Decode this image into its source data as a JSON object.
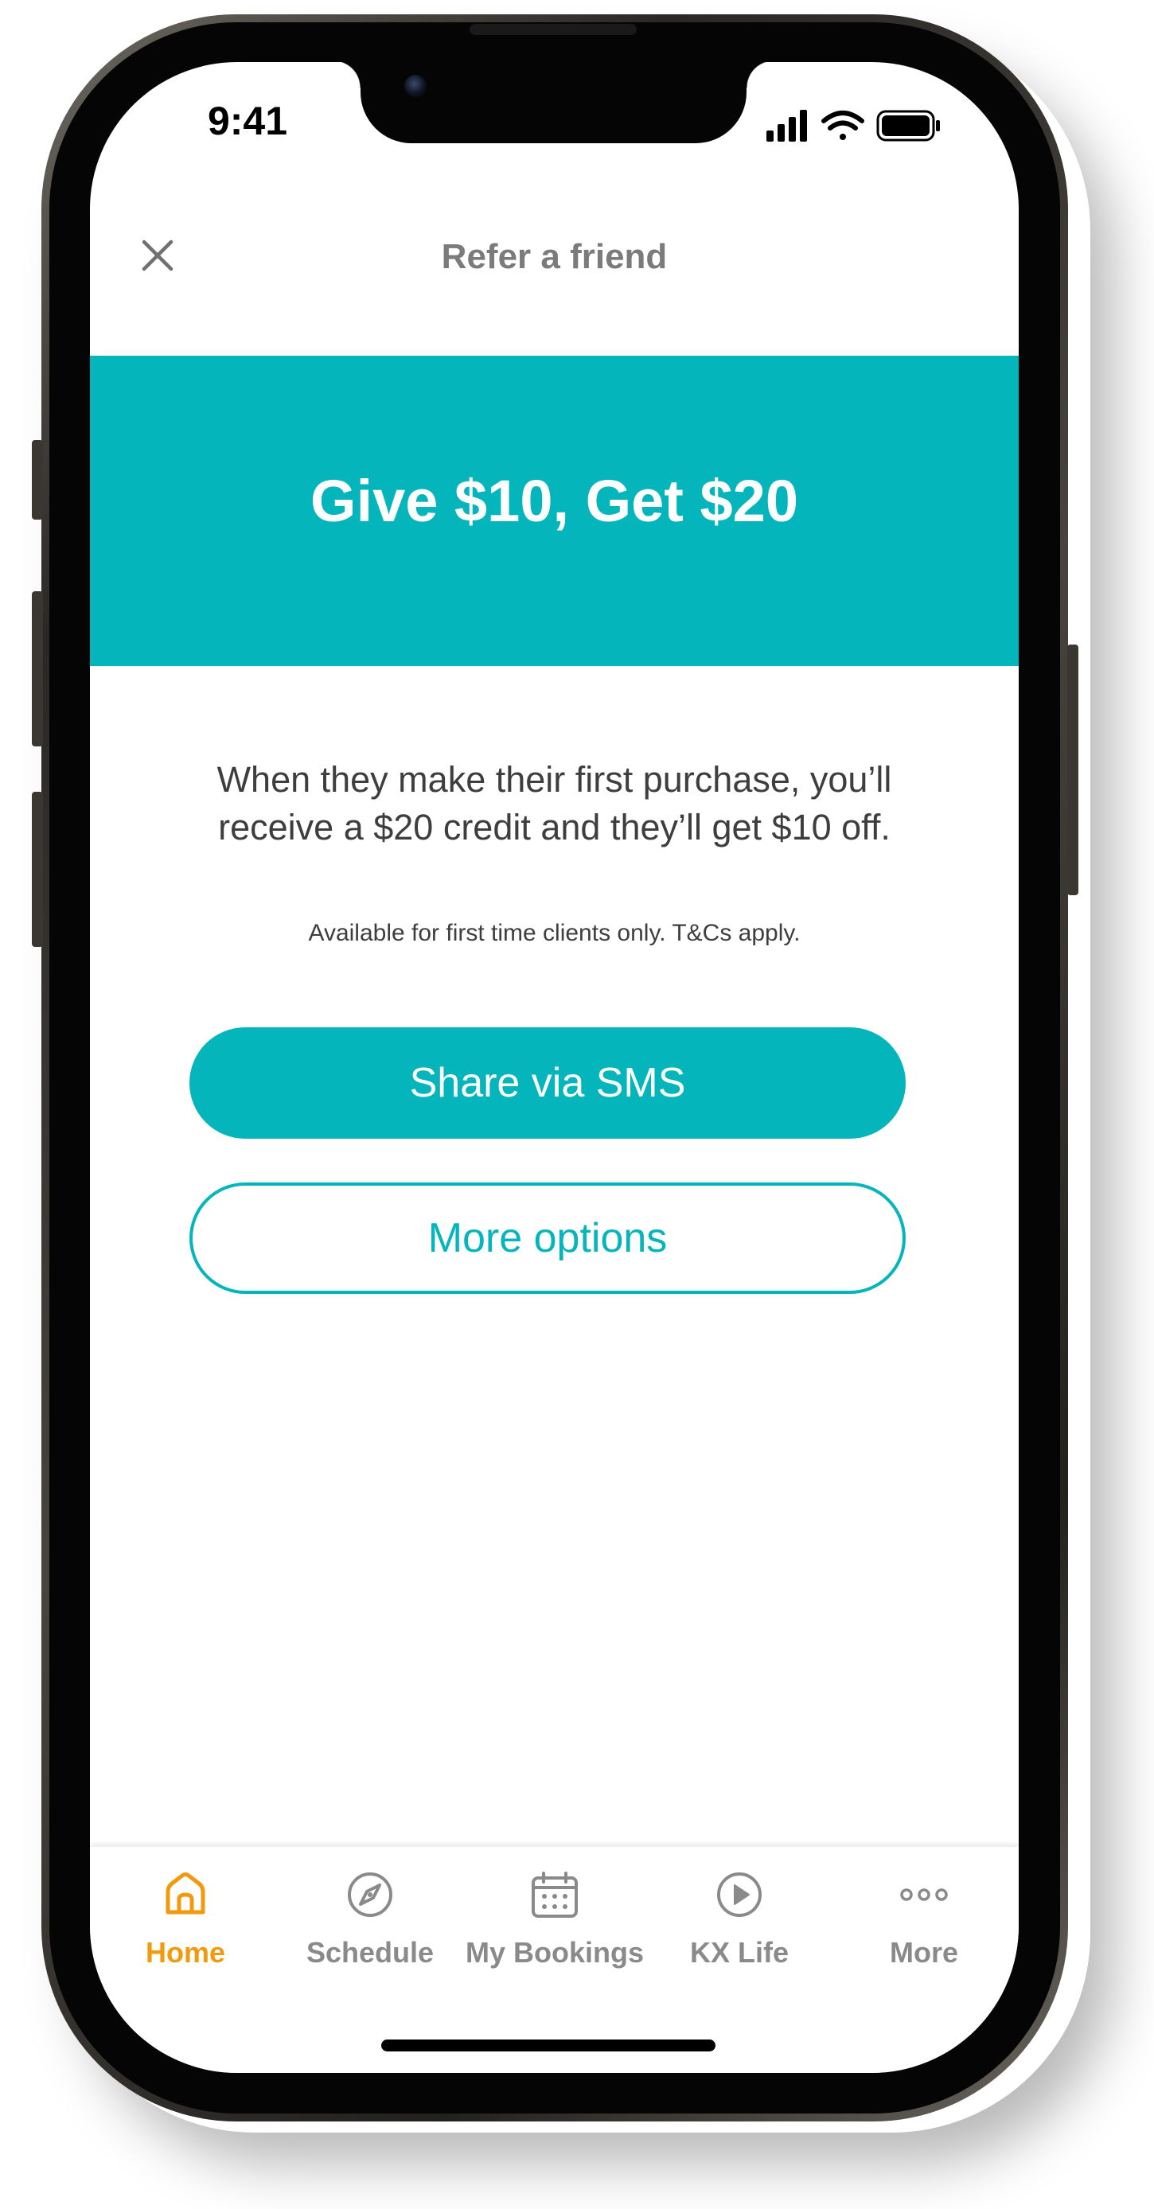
{
  "status_bar": {
    "time": "9:41",
    "icons": [
      "cellular-signal-icon",
      "wifi-icon",
      "battery-icon"
    ]
  },
  "header": {
    "title": "Refer a friend",
    "close_icon": "close-icon"
  },
  "hero": {
    "title": "Give $10, Get $20",
    "background": "#05b5bc"
  },
  "body": {
    "description_line1": "When they make their first purchase, you’ll",
    "description_line2": "receive a $20 credit and they’ll get $10 off.",
    "terms": "Available for first time clients only. T&Cs apply."
  },
  "actions": {
    "share_sms": "Share via SMS",
    "more_options": "More options"
  },
  "tabbar": {
    "items": [
      {
        "label": "Home",
        "icon": "home-icon",
        "active": true
      },
      {
        "label": "Schedule",
        "icon": "compass-icon",
        "active": false
      },
      {
        "label": "My Bookings",
        "icon": "calendar-icon",
        "active": false
      },
      {
        "label": "KX Life",
        "icon": "play-circle-icon",
        "active": false
      },
      {
        "label": "More",
        "icon": "more-dots-icon",
        "active": false
      }
    ]
  },
  "colors": {
    "accent": "#05b5bc",
    "active_tab": "#f29a0e",
    "inactive_tab": "#8a8a8a",
    "text": "#3e3e3e"
  }
}
